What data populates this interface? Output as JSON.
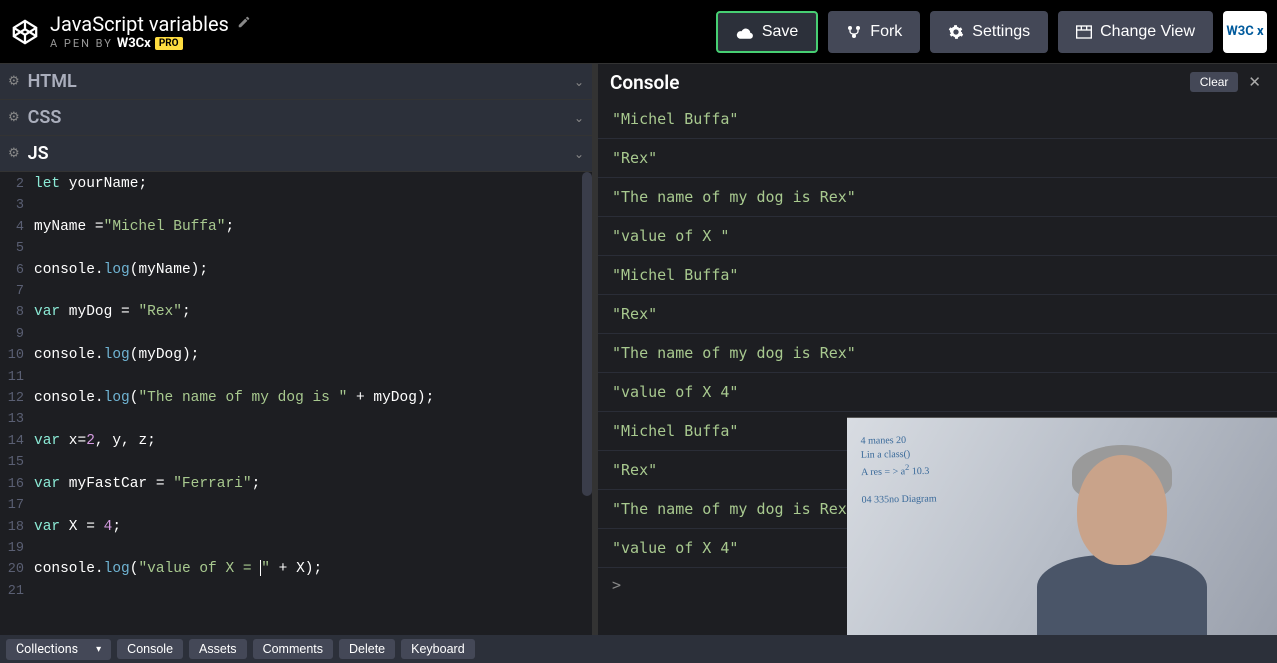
{
  "header": {
    "title": "JavaScript variables",
    "subtitle_prefix": "A PEN BY",
    "brand": "W3Cx",
    "pro": "PRO",
    "save": "Save",
    "fork": "Fork",
    "settings": "Settings",
    "change_view": "Change View",
    "w3c": "W3C x"
  },
  "panels": {
    "html": "HTML",
    "css": "CSS",
    "js": "JS"
  },
  "code": {
    "lines": [
      {
        "n": "2",
        "tokens": [
          [
            "kw",
            "let"
          ],
          [
            "",
            ""
          ],
          [
            "var",
            " yourName"
          ],
          [
            "punc",
            ";"
          ]
        ]
      },
      {
        "n": "3",
        "tokens": []
      },
      {
        "n": "4",
        "tokens": [
          [
            "var",
            "myName "
          ],
          [
            "punc",
            "="
          ],
          [
            "str",
            "\"Michel Buffa\""
          ],
          [
            "punc",
            ";"
          ]
        ]
      },
      {
        "n": "5",
        "tokens": []
      },
      {
        "n": "6",
        "tokens": [
          [
            "var",
            "console"
          ],
          [
            "punc",
            "."
          ],
          [
            "fn",
            "log"
          ],
          [
            "punc",
            "("
          ],
          [
            "var",
            "myName"
          ],
          [
            "punc",
            ");"
          ]
        ]
      },
      {
        "n": "7",
        "tokens": []
      },
      {
        "n": "8",
        "tokens": [
          [
            "kw",
            "var"
          ],
          [
            "var",
            " myDog "
          ],
          [
            "punc",
            "= "
          ],
          [
            "str",
            "\"Rex\""
          ],
          [
            "punc",
            ";"
          ]
        ]
      },
      {
        "n": "9",
        "tokens": []
      },
      {
        "n": "10",
        "tokens": [
          [
            "var",
            "console"
          ],
          [
            "punc",
            "."
          ],
          [
            "fn",
            "log"
          ],
          [
            "punc",
            "("
          ],
          [
            "var",
            "myDog"
          ],
          [
            "punc",
            ");"
          ]
        ]
      },
      {
        "n": "11",
        "tokens": []
      },
      {
        "n": "12",
        "tokens": [
          [
            "var",
            "console"
          ],
          [
            "punc",
            "."
          ],
          [
            "fn",
            "log"
          ],
          [
            "punc",
            "("
          ],
          [
            "str",
            "\"The name of my dog is \""
          ],
          [
            "punc",
            " + "
          ],
          [
            "var",
            "myDog"
          ],
          [
            "punc",
            ");"
          ]
        ]
      },
      {
        "n": "13",
        "tokens": []
      },
      {
        "n": "14",
        "tokens": [
          [
            "kw",
            "var"
          ],
          [
            "var",
            " x"
          ],
          [
            "punc",
            "="
          ],
          [
            "num",
            "2"
          ],
          [
            "punc",
            ", "
          ],
          [
            "var",
            "y"
          ],
          [
            "punc",
            ", "
          ],
          [
            "var",
            "z"
          ],
          [
            "punc",
            ";"
          ]
        ]
      },
      {
        "n": "15",
        "tokens": []
      },
      {
        "n": "16",
        "tokens": [
          [
            "kw",
            "var"
          ],
          [
            "var",
            " myFastCar "
          ],
          [
            "punc",
            "= "
          ],
          [
            "str",
            "\"Ferrari\""
          ],
          [
            "punc",
            ";"
          ]
        ]
      },
      {
        "n": "17",
        "tokens": []
      },
      {
        "n": "18",
        "tokens": [
          [
            "kw",
            "var"
          ],
          [
            "var",
            " X "
          ],
          [
            "punc",
            "= "
          ],
          [
            "num",
            "4"
          ],
          [
            "punc",
            ";"
          ]
        ]
      },
      {
        "n": "19",
        "tokens": []
      },
      {
        "n": "20",
        "tokens": [
          [
            "var",
            "console"
          ],
          [
            "punc",
            "."
          ],
          [
            "fn",
            "log"
          ],
          [
            "punc",
            "("
          ],
          [
            "str",
            "\"value of X = "
          ],
          [
            "cursor",
            ""
          ],
          [
            "str",
            "\""
          ],
          [
            "punc",
            " + "
          ],
          [
            "var",
            "X"
          ],
          [
            "punc",
            ");"
          ]
        ]
      },
      {
        "n": "21",
        "tokens": []
      }
    ]
  },
  "console": {
    "title": "Console",
    "clear": "Clear",
    "lines": [
      "\"Michel Buffa\"",
      "\"Rex\"",
      "\"The name of my dog is Rex\"",
      "\"value of X \"",
      "\"Michel Buffa\"",
      "\"Rex\"",
      "\"The name of my dog is Rex\"",
      "\"value of X 4\"",
      "\"Michel Buffa\"",
      "\"Rex\"",
      "\"The name of my dog is Rex\"",
      "\"value of X 4\""
    ],
    "prompt": ">"
  },
  "footer": {
    "collections": "Collections",
    "console": "Console",
    "assets": "Assets",
    "comments": "Comments",
    "delete": "Delete",
    "keyboard": "Keyboard"
  }
}
